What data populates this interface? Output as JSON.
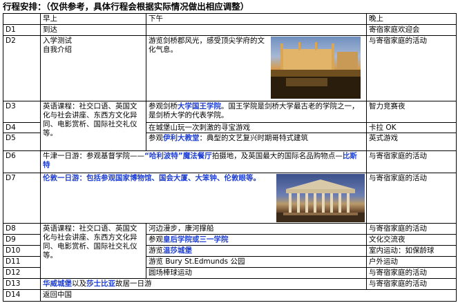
{
  "title": "行程安排：（仅供参考，具体行程会根据实际情况做出相应调整）",
  "header": {
    "col_day": "",
    "col_morning": "早上",
    "col_afternoon": "下午",
    "col_evening": "晚上"
  },
  "rows": {
    "d1": {
      "day": "D1",
      "morning": "到达",
      "evening": "寄宿家庭欢迎会"
    },
    "d2": {
      "day": "D2",
      "morning_1": "入学测试",
      "morning_2": "自我介绍",
      "afternoon": "游览剑桥郡风光，感受顶尖学府的文化气息。",
      "evening": "与寄宿家庭的活动"
    },
    "d3": {
      "day": "D3",
      "afternoon_prefix": "参观剑桥",
      "afternoon_link": "大学国王学院",
      "afternoon_suffix": "。国王学院是剑桥大学最古老的学院之一，是剑桥大学的代表学院。",
      "evening": "智力竞赛夜"
    },
    "d4": {
      "day": "D4",
      "afternoon": "在城堡山玩一次刺激的寻宝游戏",
      "evening": "卡拉 OK"
    },
    "d5": {
      "day": "D5",
      "afternoon_prefix": "参观",
      "afternoon_link": "伊利大教堂",
      "afternoon_suffix": "：典型的文艺复兴时期哥特式建筑",
      "evening": "英式游戏"
    },
    "d3_5_morning": "英语课程：社交口语、英国文化与社会讲座、东西方文化异同、电影赏析、国际社交礼仪等。",
    "d6": {
      "day": "D6",
      "text_1": "牛津一日游：参观基督学院——",
      "text_link_1": "“哈利波特”魔法餐厅",
      "text_2": "拍摄地，及英国最大的国际名品购物点—",
      "text_link_2": "比斯特",
      "evening": "与寄宿家庭的活动"
    },
    "d7": {
      "day": "D7",
      "text": "伦敦一日游：包括参观国家博物馆、国会大厦、大笨钟、伦敦眼等。",
      "evening": "与寄宿家庭的活动"
    },
    "d8": {
      "day": "D8",
      "afternoon": "河边漫步，康河撑船",
      "evening": "与寄宿家庭的活动"
    },
    "d9": {
      "day": "D9",
      "afternoon_prefix": "参观",
      "afternoon_link": "皇后学院或三一学院",
      "evening": "文化交流夜"
    },
    "d10": {
      "day": "D10",
      "afternoon_prefix": "游览",
      "afternoon_link": "温莎城堡",
      "evening": "室内运动：如保龄球"
    },
    "d11": {
      "day": "D11",
      "afternoon": "游览 Bury St.Edmunds 公园",
      "evening": "户外运动"
    },
    "d12": {
      "day": "D12",
      "afternoon": "圆场棒球运动",
      "evening": "与寄宿家庭的活动"
    },
    "d8_12_morning": "英语课程：社交口语、英国文化与社会讲座、东西方文化异同、电影赏析、国际社交礼仪等。",
    "d13": {
      "day": "D13",
      "link_1": "华威城堡",
      "mid": "以及",
      "link_2": "莎士比亚",
      "suffix": "故居一日游",
      "evening": "与寄宿家庭的活动"
    },
    "d14": {
      "day": "D14",
      "text": "返回中国"
    }
  },
  "colors": {
    "link_blue": "#1f3fcf",
    "border": "#000000"
  }
}
